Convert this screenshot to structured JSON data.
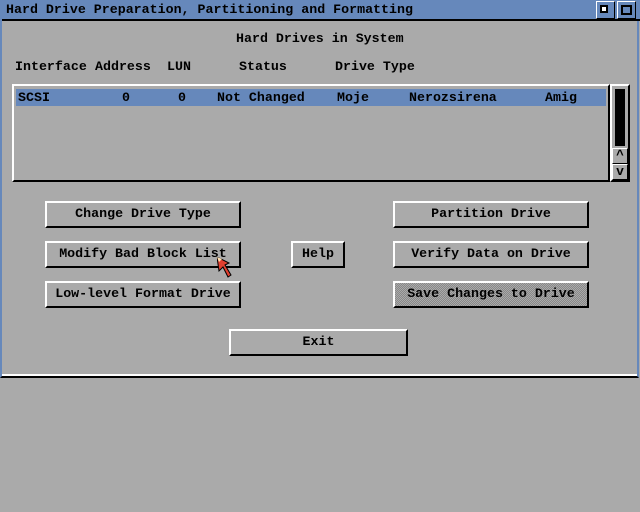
{
  "window": {
    "title": "Hard Drive Preparation, Partitioning and Formatting"
  },
  "section_title": "Hard Drives in System",
  "columns": [
    "Interface",
    "Address",
    "LUN",
    "Status",
    "Drive Type"
  ],
  "rows": [
    {
      "interface": "SCSI",
      "address": "0",
      "lun": "0",
      "status": "Not Changed",
      "type1": "Moje",
      "type2": "Nerozsirena",
      "type3": "Amig",
      "selected": true
    }
  ],
  "scrollbar": {
    "up": "^",
    "down": "v"
  },
  "buttons": {
    "change_type": "Change Drive Type",
    "modify_bad": "Modify Bad Block List",
    "lowlevel": "Low-level Format Drive",
    "help": "Help",
    "partition": "Partition Drive",
    "verify": "Verify Data on Drive",
    "save": "Save Changes to Drive",
    "exit": "Exit"
  },
  "colors": {
    "background": "#aaaaaa",
    "titlebar": "#6688bb",
    "selection": "#6688bb"
  }
}
